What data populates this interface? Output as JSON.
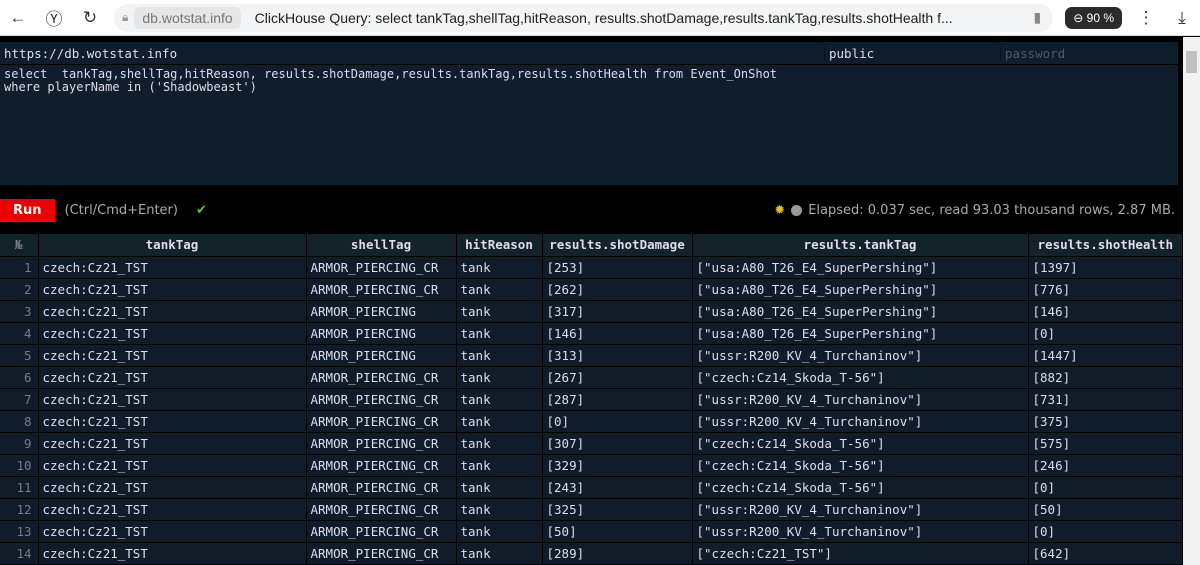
{
  "browser": {
    "host": "db.wotstat.info",
    "title": "ClickHouse Query: select tankTag,shellTag,hitReason, results.shotDamage,results.tankTag,results.shotHealth f...",
    "zoom": "90 %"
  },
  "connection": {
    "url": "https://db.wotstat.info",
    "user": "public",
    "password_placeholder": "password"
  },
  "query": "select  tankTag,shellTag,hitReason, results.shotDamage,results.tankTag,results.shotHealth from Event_OnShot\nwhere playerName in ('Shadowbeast')",
  "run": {
    "label": "Run",
    "hint": "(Ctrl/Cmd+Enter)",
    "check": "✔",
    "status": "Elapsed: 0.037 sec, read 93.03 thousand rows, 2.87 MB."
  },
  "table": {
    "columns": [
      "№",
      "tankTag",
      "shellTag",
      "hitReason",
      "results.shotDamage",
      "results.tankTag",
      "results.shotHealth"
    ],
    "rows": [
      [
        "1",
        "czech:Cz21_TST",
        "ARMOR_PIERCING_CR",
        "tank",
        "[253]",
        "[\"usa:A80_T26_E4_SuperPershing\"]",
        "[1397]"
      ],
      [
        "2",
        "czech:Cz21_TST",
        "ARMOR_PIERCING_CR",
        "tank",
        "[262]",
        "[\"usa:A80_T26_E4_SuperPershing\"]",
        "[776]"
      ],
      [
        "3",
        "czech:Cz21_TST",
        "ARMOR_PIERCING",
        "tank",
        "[317]",
        "[\"usa:A80_T26_E4_SuperPershing\"]",
        "[146]"
      ],
      [
        "4",
        "czech:Cz21_TST",
        "ARMOR_PIERCING",
        "tank",
        "[146]",
        "[\"usa:A80_T26_E4_SuperPershing\"]",
        "[0]"
      ],
      [
        "5",
        "czech:Cz21_TST",
        "ARMOR_PIERCING",
        "tank",
        "[313]",
        "[\"ussr:R200_KV_4_Turchaninov\"]",
        "[1447]"
      ],
      [
        "6",
        "czech:Cz21_TST",
        "ARMOR_PIERCING_CR",
        "tank",
        "[267]",
        "[\"czech:Cz14_Skoda_T-56\"]",
        "[882]"
      ],
      [
        "7",
        "czech:Cz21_TST",
        "ARMOR_PIERCING_CR",
        "tank",
        "[287]",
        "[\"ussr:R200_KV_4_Turchaninov\"]",
        "[731]"
      ],
      [
        "8",
        "czech:Cz21_TST",
        "ARMOR_PIERCING_CR",
        "tank",
        "[0]",
        "[\"ussr:R200_KV_4_Turchaninov\"]",
        "[375]"
      ],
      [
        "9",
        "czech:Cz21_TST",
        "ARMOR_PIERCING_CR",
        "tank",
        "[307]",
        "[\"czech:Cz14_Skoda_T-56\"]",
        "[575]"
      ],
      [
        "10",
        "czech:Cz21_TST",
        "ARMOR_PIERCING_CR",
        "tank",
        "[329]",
        "[\"czech:Cz14_Skoda_T-56\"]",
        "[246]"
      ],
      [
        "11",
        "czech:Cz21_TST",
        "ARMOR_PIERCING_CR",
        "tank",
        "[243]",
        "[\"czech:Cz14_Skoda_T-56\"]",
        "[0]"
      ],
      [
        "12",
        "czech:Cz21_TST",
        "ARMOR_PIERCING_CR",
        "tank",
        "[325]",
        "[\"ussr:R200_KV_4_Turchaninov\"]",
        "[50]"
      ],
      [
        "13",
        "czech:Cz21_TST",
        "ARMOR_PIERCING_CR",
        "tank",
        "[50]",
        "[\"ussr:R200_KV_4_Turchaninov\"]",
        "[0]"
      ],
      [
        "14",
        "czech:Cz21_TST",
        "ARMOR_PIERCING_CR",
        "tank",
        "[289]",
        "[\"czech:Cz21_TST\"]",
        "[642]"
      ]
    ]
  }
}
